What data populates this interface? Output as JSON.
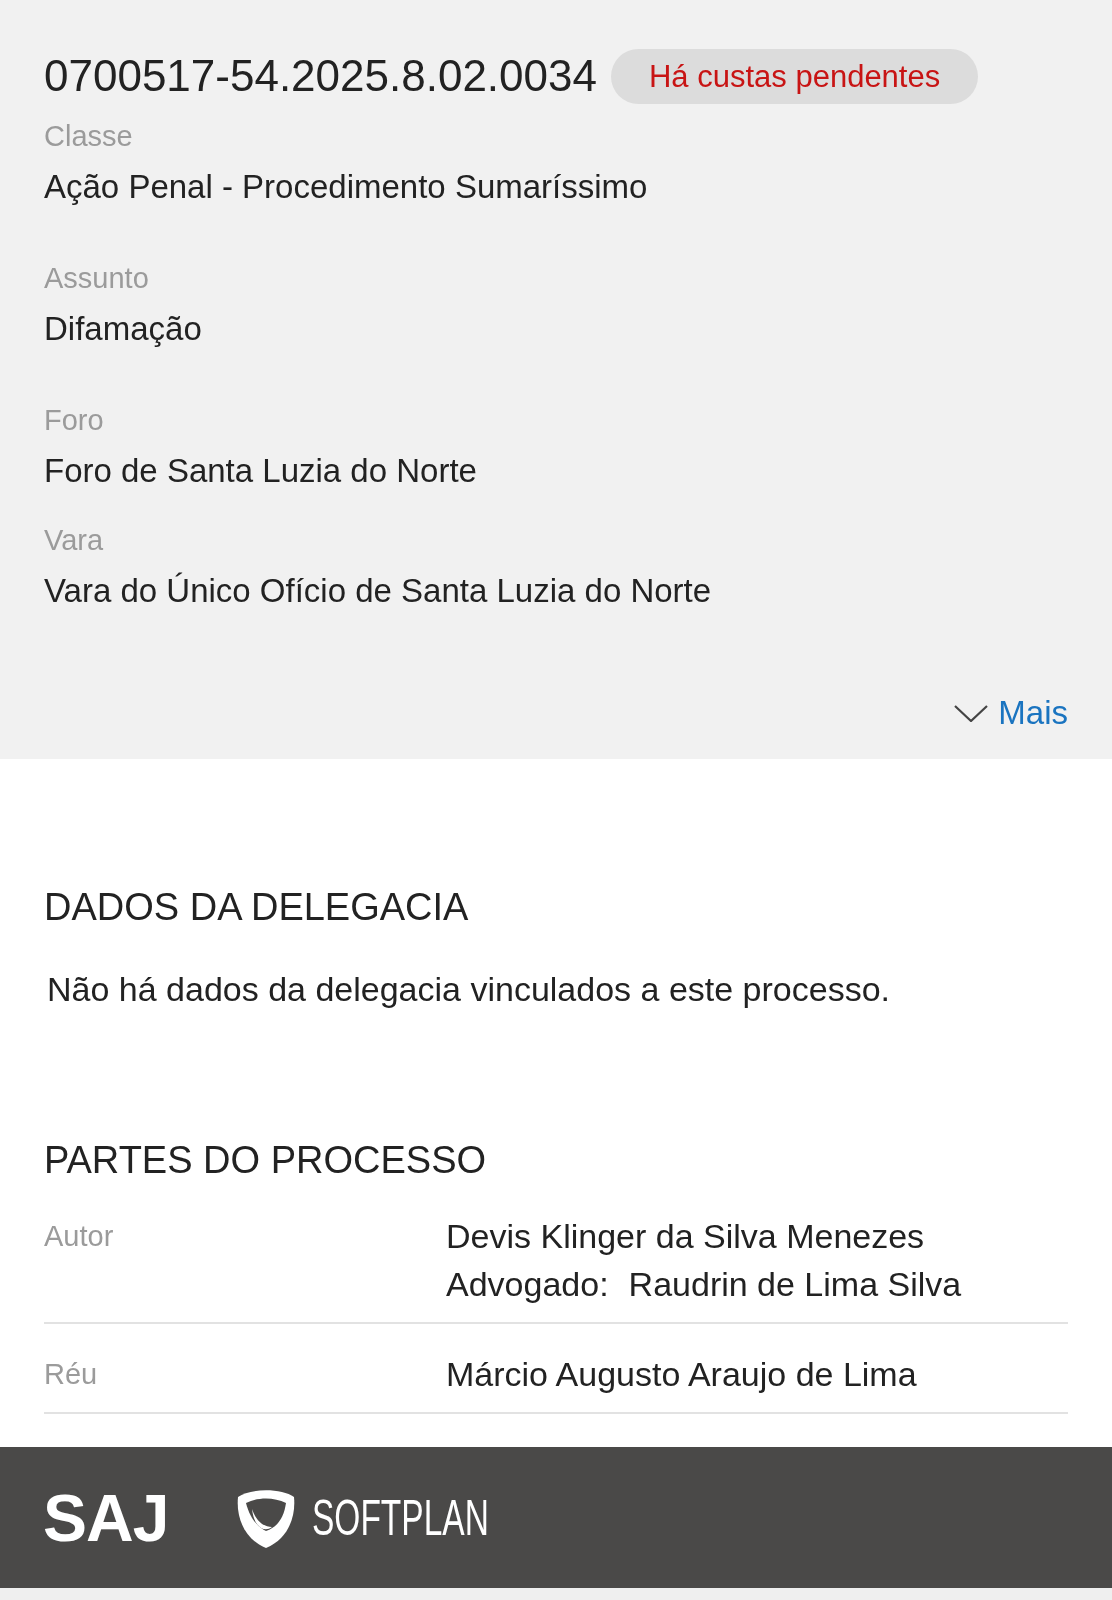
{
  "process": {
    "number": "0700517-54.2025.8.02.0034",
    "badge": "Há custas pendentes",
    "fields": [
      {
        "label": "Classe",
        "value": "Ação Penal - Procedimento Sumaríssimo"
      },
      {
        "label": "Assunto",
        "value": "Difamação"
      },
      {
        "label": "Foro",
        "value": "Foro de Santa Luzia do Norte"
      },
      {
        "label": "Vara",
        "value": "Vara do Único Ofício de Santa Luzia do Norte"
      }
    ],
    "more_link": "Mais"
  },
  "police_data": {
    "title": "DADOS DA DELEGACIA",
    "message": "Não há dados da delegacia vinculados a este processo."
  },
  "parties": {
    "title": "PARTES DO PROCESSO",
    "rows": [
      {
        "role": "Autor",
        "name": "Devis Klinger da Silva Menezes",
        "lawyer": {
          "label": "Advogado:",
          "name": "Raudrin de Lima Silva"
        }
      },
      {
        "role": "Réu",
        "name": "Márcio Augusto Araujo de Lima"
      }
    ]
  },
  "footer": {
    "logos": [
      {
        "kind": "mark",
        "text": "SAJ"
      },
      {
        "kind": "emblem",
        "text": "SOFTPLAN"
      }
    ]
  }
}
